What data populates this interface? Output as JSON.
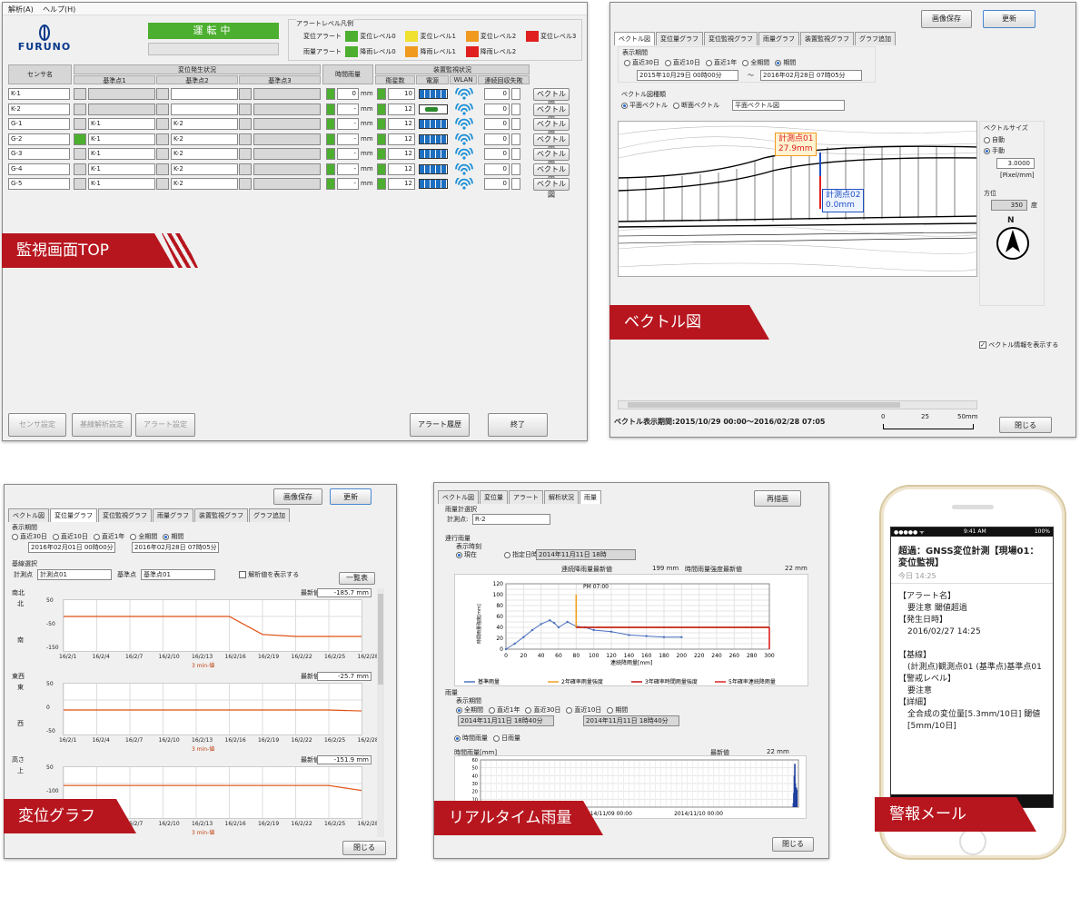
{
  "colors": {
    "accent_red": "#b7161f",
    "level0": "#4caf2f",
    "level1": "#f0e030",
    "level2": "#f09a20",
    "level3": "#e02020",
    "ok_green": "#4caf2f",
    "wlan": "#1e90d6"
  },
  "top": {
    "menu": [
      "解析(A)",
      "ヘルプ(H)"
    ],
    "logo": "FURUNO",
    "status": "運転中",
    "legend_title": "アラートレベル凡例",
    "legend_rows": [
      {
        "label": "変位アラート",
        "items": [
          "変位レベル0",
          "変位レベル1",
          "変位レベル2",
          "変位レベル3"
        ]
      },
      {
        "label": "雨量アラート",
        "items": [
          "降雨レベル0",
          "降雨レベル1",
          "降雨レベル2"
        ]
      }
    ],
    "headers": {
      "sensor": "センサ名",
      "disp": "変位発生状況",
      "ref1": "基準点1",
      "ref2": "基準点2",
      "ref3": "基準点3",
      "rain": "時間雨量",
      "dev": "装置監視状況",
      "sol": "衛星数",
      "pwr": "電源",
      "wlan": "WLAN",
      "fail": "連続回収失敗"
    },
    "rows": [
      {
        "name": "K-1",
        "r1": "",
        "r2": "",
        "rain": "0",
        "sat": "10",
        "fail": "0",
        "ind": false
      },
      {
        "name": "K-2",
        "r1": "",
        "r2": "",
        "rain": "-",
        "sat": "12",
        "fail": "0",
        "ind": false
      },
      {
        "name": "G-1",
        "r1": "K-1",
        "r2": "K-2",
        "rain": "-",
        "sat": "12",
        "fail": "0",
        "ind": false
      },
      {
        "name": "G-2",
        "r1": "K-1",
        "r2": "K-2",
        "rain": "-",
        "sat": "12",
        "fail": "0",
        "ind": true
      },
      {
        "name": "G-3",
        "r1": "K-1",
        "r2": "K-2",
        "rain": "-",
        "sat": "12",
        "fail": "0",
        "ind": false
      },
      {
        "name": "G-4",
        "r1": "K-1",
        "r2": "K-2",
        "rain": "-",
        "sat": "12",
        "fail": "0",
        "ind": false
      },
      {
        "name": "G-5",
        "r1": "K-1",
        "r2": "K-2",
        "rain": "-",
        "sat": "12",
        "fail": "0",
        "ind": false
      }
    ],
    "unit": "mm",
    "vector_btn": "ベクトル図",
    "footer": [
      "センサ設定",
      "基線解析設定",
      "アラート設定",
      "アラート履歴",
      "終了"
    ],
    "banner": "監視画面TOP"
  },
  "vector": {
    "buttons": [
      "画像保存",
      "更新"
    ],
    "tabs": [
      "ベクトル図",
      "変位量グラフ",
      "変位監視グラフ",
      "雨量グラフ",
      "装置監視グラフ",
      "グラフ追加"
    ],
    "period_label": "表示期間",
    "period_opts": [
      "直近30日",
      "直近10日",
      "直近1年",
      "全期間",
      "期間"
    ],
    "from": "2015年10月29日 00時00分",
    "to": "2016年02月28日 07時05分",
    "tilde": "〜",
    "type_label": "ベクトル図種類",
    "type_opts": [
      "平面ベクトル",
      "断面ベクトル"
    ],
    "type_select": "平面ベクトル図",
    "p1_name": "計測点01",
    "p1_val": "27.9mm",
    "p2_name": "計測点02",
    "p2_val": "0.0mm",
    "size_label": "ベクトルサイズ",
    "auto": "自動",
    "manual": "手動",
    "size_val": "3.0000",
    "size_unit": "[Pixel/mm]",
    "dir_label": "方位",
    "dir_val": "350",
    "dir_unit": "度",
    "north": "N",
    "show_info": "ベクトル情報を表示する",
    "period_text": "ベクトル表示期間:2015/10/29 00:00〜2016/02/28 07:05",
    "scale": [
      "0",
      "25",
      "50mm"
    ],
    "close": "閉じる",
    "banner": "ベクトル図"
  },
  "disp": {
    "buttons": [
      "画像保存",
      "更新"
    ],
    "tabs": [
      "ベクトル図",
      "変位量グラフ",
      "変位監視グラフ",
      "雨量グラフ",
      "装置監視グラフ",
      "グラフ追加"
    ],
    "period_label": "表示期間",
    "period_opts": [
      "直近30日",
      "直近10日",
      "直近1年",
      "全期間",
      "期間"
    ],
    "from": "2016年02月01日 00時00分",
    "to": "2016年02月28日 07時05分",
    "base_label": "基線選択",
    "pt_label": "計測点",
    "pt_val": "計測点01",
    "ref_label": "基準点",
    "ref_val": "基準点01",
    "check": "解析値を表示する",
    "list_btn": "一覧表",
    "latest": "最新値",
    "xticks": [
      "16/2/1",
      "16/2/4",
      "16/2/7",
      "16/2/10",
      "16/2/13",
      "16/2/16",
      "16/2/19",
      "16/2/22",
      "16/2/25",
      "16/2/28"
    ],
    "legend": "3 min-値",
    "panels": [
      {
        "title": "南北",
        "top": "北",
        "bot": "南",
        "latest": "-185.7 mm",
        "y": [
          "50",
          "-50",
          "-150"
        ]
      },
      {
        "title": "東西",
        "top": "東",
        "bot": "西",
        "latest": "-25.7 mm",
        "y": [
          "50",
          "0",
          "-50"
        ]
      },
      {
        "title": "高さ",
        "top": "上",
        "bot": "",
        "latest": "-151.9 mm",
        "y": [
          "50",
          "-100",
          ""
        ]
      }
    ],
    "close": "閉じる",
    "banner": "変位グラフ"
  },
  "rain": {
    "tabs": [
      "ベクトル図",
      "変位量",
      "アラート",
      "解析状況",
      "雨量"
    ],
    "redraw": "再描画",
    "pt_section": "雨量計選択",
    "pt_label": "計測点:",
    "pt_val": "R-2",
    "cont_label": "連行雨量",
    "period_label": "表示時刻",
    "now": "現在",
    "specify": "指定日時",
    "spec_val": "2014年11月11日 18時",
    "stat1": "連続降雨量最新値",
    "stat1_val": "199 mm",
    "stat2": "時間雨量強度最新値",
    "stat2_val": "22 mm",
    "chart_title": "PM 07:00",
    "xlabel": "連続降雨量[mm]",
    "chart_legend": [
      "基準雨量",
      "2年確率雨量強度",
      "3年確率時間雨量強度",
      "5年確率連続降雨量"
    ],
    "rain_label": "雨量",
    "rain_period": "表示期間",
    "rain_opts": [
      "全期間",
      "直近1年",
      "直近30日",
      "直近10日",
      "期間"
    ],
    "r_from": "2014年11月11日 18時40分",
    "r_to": "2014年11月11日 18時40分",
    "mode_opts": [
      "時間雨量",
      "日雨量"
    ],
    "hourly_label": "時間雨量[mm]",
    "latest": "最新値",
    "latest_val": "22 mm",
    "x2": [
      "2014/11/09 00:00",
      "2014/11/10 00:00"
    ],
    "close": "閉じる",
    "banner": "リアルタイム雨量"
  },
  "phone": {
    "carrier": "●●●●● ᯤ",
    "time": "9:41 AM",
    "batt": "100%",
    "subject": "超過：GNSS変位計測【現場01：変位監視】",
    "date": "今日 14:25",
    "body": [
      "【アラート名】",
      "要注意 閾値超過",
      "【発生日時】",
      "2016/02/27 14:25",
      "",
      "【基線】",
      "(計測点)観測点01 (基準点)基準点01",
      "【警戒レベル】",
      "要注意",
      "【詳細】",
      "全合成の変位量[5.3mm/10日] 閾値[5mm/10日]"
    ],
    "banner": "警報メール"
  },
  "chart_data": [
    {
      "type": "line",
      "title": "PM 07:00",
      "xlabel": "連続降雨量[mm]",
      "ylabel": "時間雨量強度[mm]",
      "xlim": [
        0,
        300
      ],
      "ylim": [
        0,
        120
      ],
      "xticks": [
        0,
        20,
        40,
        60,
        80,
        100,
        120,
        140,
        160,
        180,
        200,
        220,
        240,
        260,
        280,
        300
      ],
      "yticks": [
        0,
        10,
        20,
        30,
        40,
        50,
        60,
        70,
        80,
        90,
        100,
        110,
        120
      ],
      "series": [
        {
          "name": "基準雨量",
          "x": [
            0,
            10,
            20,
            30,
            40,
            50,
            55,
            60,
            70,
            80,
            90,
            100,
            120,
            140,
            160,
            180,
            200
          ],
          "y": [
            0,
            10,
            22,
            35,
            46,
            53,
            48,
            40,
            50,
            42,
            40,
            35,
            32,
            26,
            24,
            22,
            22
          ]
        },
        {
          "name": "2年確率雨量強度",
          "x": [
            80,
            80,
            300
          ],
          "y": [
            100,
            40,
            40
          ]
        },
        {
          "name": "3年確率時間雨量強度",
          "x": [
            80,
            300
          ],
          "y": [
            40,
            40
          ]
        },
        {
          "name": "5年確率連続降雨量",
          "x": [
            300,
            300
          ],
          "y": [
            40,
            0
          ]
        }
      ]
    },
    {
      "type": "bar",
      "title": "",
      "ylabel": "時間雨量[mm]",
      "ylim": [
        0,
        60
      ],
      "yticks": [
        0,
        10,
        20,
        30,
        40,
        50,
        60
      ],
      "x": [
        "2014/11/09 00:00",
        "2014/11/10 00:00"
      ],
      "values": [
        0,
        0,
        0,
        0,
        0,
        0,
        0,
        0,
        0,
        0,
        0,
        0,
        0,
        0,
        0,
        0,
        5,
        18,
        40,
        55,
        30,
        20,
        25,
        22
      ]
    }
  ]
}
